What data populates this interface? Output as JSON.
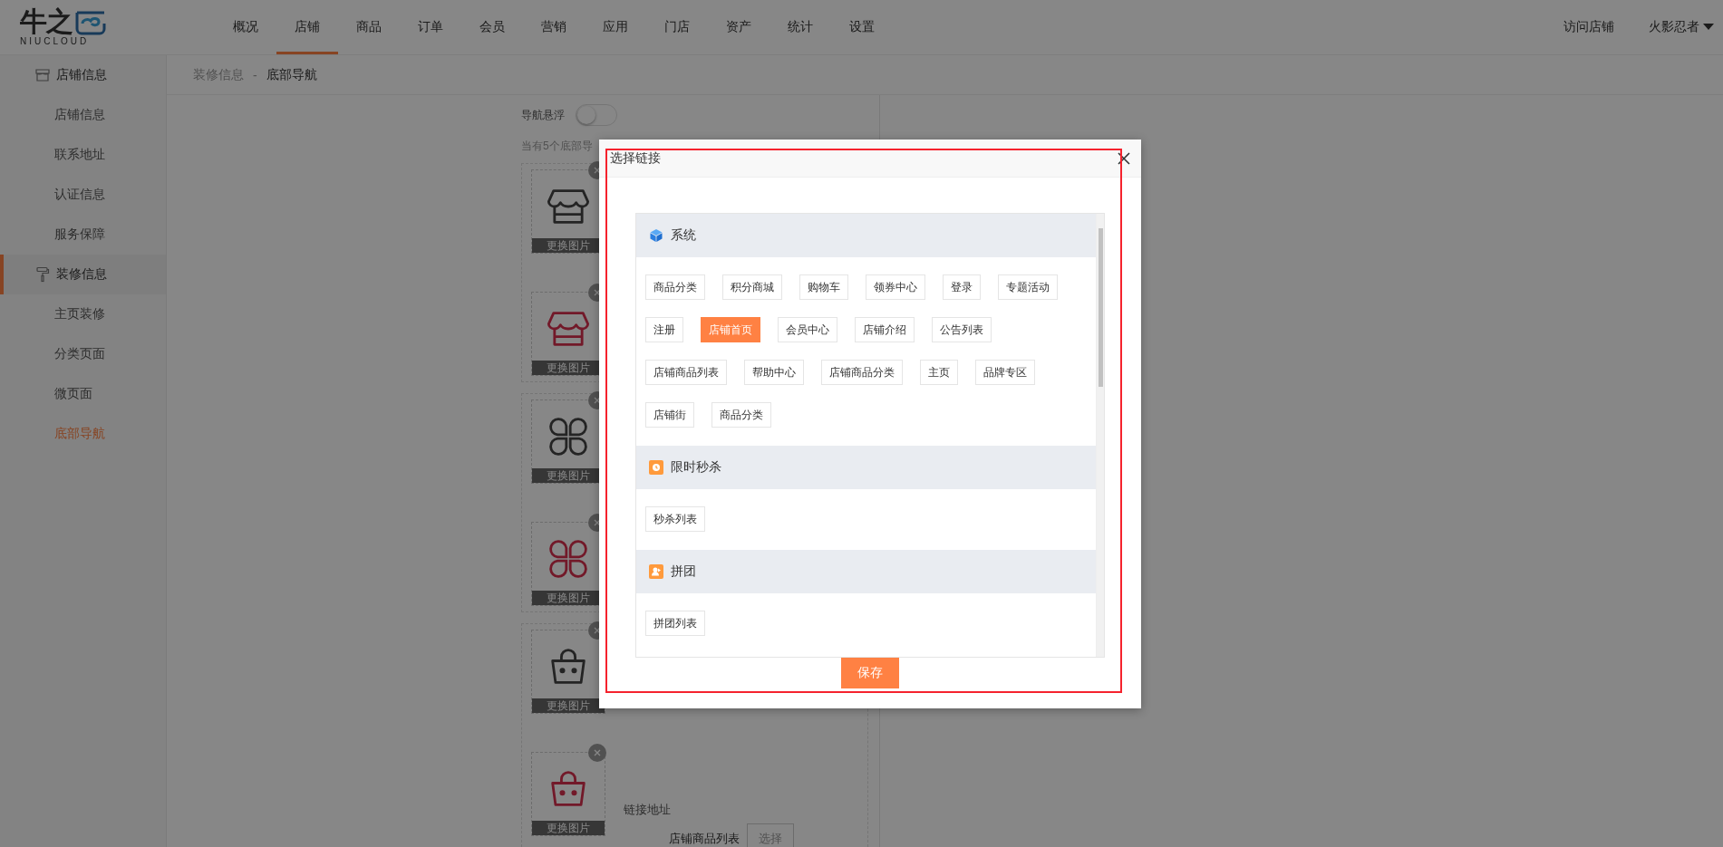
{
  "header": {
    "logo": {
      "mark": "牛之",
      "sub": "NIUCLOUD"
    },
    "nav": [
      {
        "label": "概况",
        "selected": false
      },
      {
        "label": "店铺",
        "selected": true
      },
      {
        "label": "商品",
        "selected": false
      },
      {
        "label": "订单",
        "selected": false
      },
      {
        "label": "会员",
        "selected": false
      },
      {
        "label": "营销",
        "selected": false
      },
      {
        "label": "应用",
        "selected": false
      },
      {
        "label": "门店",
        "selected": false
      },
      {
        "label": "资产",
        "selected": false
      },
      {
        "label": "统计",
        "selected": false
      },
      {
        "label": "设置",
        "selected": false
      }
    ],
    "visit": "访问店铺",
    "user": "火影忍者"
  },
  "sidebar": {
    "groups": [
      {
        "label": "店铺信息",
        "kind": "store",
        "selected": false,
        "children": [
          {
            "label": "店铺信息",
            "selected": false
          },
          {
            "label": "联系地址",
            "selected": false
          },
          {
            "label": "认证信息",
            "selected": false
          },
          {
            "label": "服务保障",
            "selected": false
          }
        ]
      },
      {
        "label": "装修信息",
        "kind": "roller",
        "selected": true,
        "children": [
          {
            "label": "主页装修",
            "selected": false
          },
          {
            "label": "分类页面",
            "selected": false
          },
          {
            "label": "微页面",
            "selected": false
          },
          {
            "label": "底部导航",
            "selected": true
          }
        ]
      }
    ]
  },
  "breadcrumb": {
    "items": [
      "装修信息",
      "底部导航"
    ],
    "separator": "-"
  },
  "editor": {
    "float_toggle": {
      "label": "导航悬浮",
      "on": false
    },
    "hint": "当有5个底部导",
    "items": [
      {
        "tiles": [
          {
            "kind": "store",
            "highlighted": false,
            "button": "更换图片"
          },
          {
            "kind": "store",
            "highlighted": true,
            "button": "更换图片"
          }
        ]
      },
      {
        "tiles": [
          {
            "kind": "clover",
            "highlighted": false,
            "button": "更换图片"
          },
          {
            "kind": "clover",
            "highlighted": true,
            "button": "更换图片"
          }
        ]
      },
      {
        "tiles": [
          {
            "kind": "bag",
            "highlighted": false,
            "button": "更换图片"
          },
          {
            "kind": "bag",
            "highlighted": true,
            "button": "更换图片"
          }
        ],
        "link": {
          "label": "链接地址",
          "value": "店铺商品列表",
          "button": "选择"
        }
      }
    ]
  },
  "modal": {
    "title": "选择链接",
    "save": "保存",
    "sections": [
      {
        "title": "系统",
        "kind": "system",
        "links": [
          {
            "label": "商品分类",
            "selected": false
          },
          {
            "label": "积分商城",
            "selected": false
          },
          {
            "label": "购物车",
            "selected": false
          },
          {
            "label": "领券中心",
            "selected": false
          },
          {
            "label": "登录",
            "selected": false
          },
          {
            "label": "专题活动",
            "selected": false
          },
          {
            "label": "注册",
            "selected": false
          },
          {
            "label": "店铺首页",
            "selected": true
          },
          {
            "label": "会员中心",
            "selected": false
          },
          {
            "label": "店铺介绍",
            "selected": false
          },
          {
            "label": "公告列表",
            "selected": false
          },
          {
            "label": "店铺商品列表",
            "selected": false
          },
          {
            "label": "帮助中心",
            "selected": false
          },
          {
            "label": "店铺商品分类",
            "selected": false
          },
          {
            "label": "主页",
            "selected": false
          },
          {
            "label": "品牌专区",
            "selected": false
          },
          {
            "label": "店铺街",
            "selected": false
          },
          {
            "label": "商品分类",
            "selected": false
          }
        ]
      },
      {
        "title": "限时秒杀",
        "kind": "seckill",
        "links": [
          {
            "label": "秒杀列表",
            "selected": false
          }
        ]
      },
      {
        "title": "拼团",
        "kind": "group",
        "links": [
          {
            "label": "拼团列表",
            "selected": false
          }
        ]
      }
    ]
  }
}
